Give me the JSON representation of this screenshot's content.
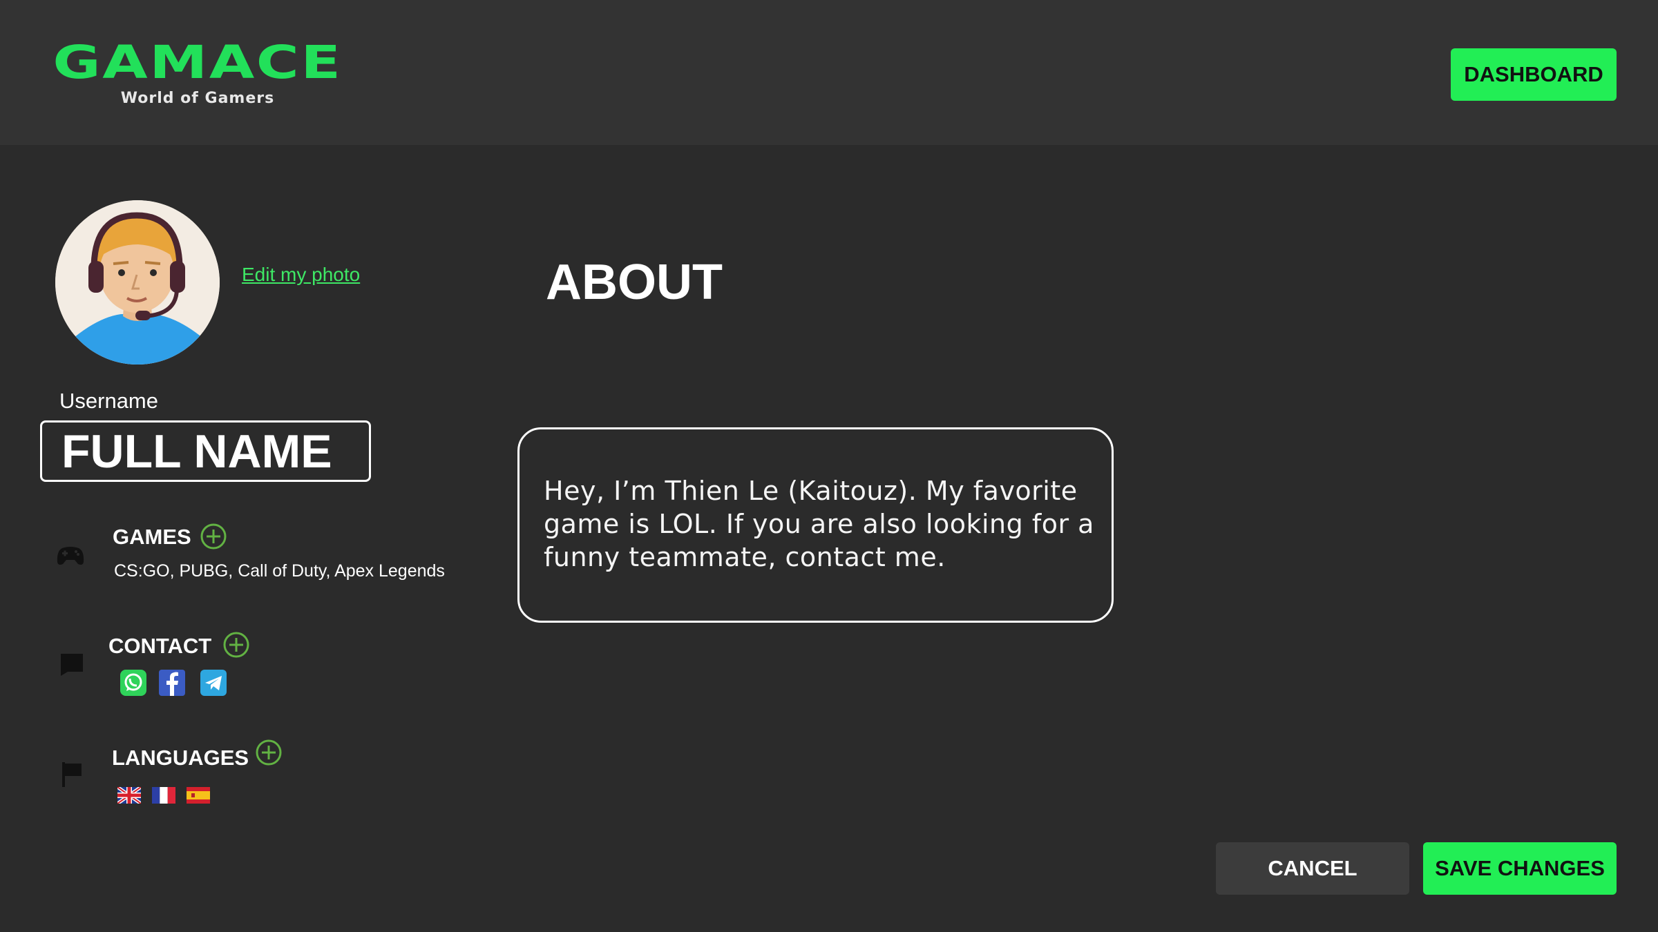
{
  "brand": {
    "name": "GAMACE",
    "tagline": "World of Gamers",
    "accent_color": "#22ee55"
  },
  "header": {
    "dashboard_label": "DASHBOARD"
  },
  "profile": {
    "edit_photo_label": "Edit my photo",
    "username_label": "Username",
    "username_value": "FULL NAME"
  },
  "about": {
    "title": "ABOUT",
    "text": "Hey, I’m Thien Le (Kaitouz). My favorite game is LOL. If you are also looking for a funny teammate, contact me."
  },
  "sections": {
    "games": {
      "title": "GAMES",
      "icon": "gamepad-icon",
      "list": "CS:GO, PUBG, Call of Duty, Apex Legends"
    },
    "contact": {
      "title": "CONTACT",
      "icon": "chat-icon",
      "links": [
        "whatsapp-icon",
        "facebook-icon",
        "telegram-icon"
      ]
    },
    "languages": {
      "title": "LANGUAGES",
      "icon": "flag-icon",
      "flags": [
        "uk-flag-icon",
        "france-flag-icon",
        "spain-flag-icon"
      ]
    }
  },
  "actions": {
    "cancel_label": "CANCEL",
    "save_label": "SAVE CHANGES"
  }
}
